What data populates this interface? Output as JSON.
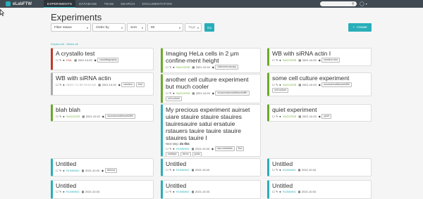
{
  "nav": {
    "brand": "eLabFTW",
    "items": [
      "EXPERIMENTS",
      "DATABASE",
      "TEAM",
      "SEARCH",
      "DOCUMENTATION"
    ],
    "active_index": 0
  },
  "page": {
    "title": "Experiments"
  },
  "filters": {
    "status": "Filter status",
    "order": "Order by",
    "sort": "Sort",
    "limit": "60",
    "tags": "Tags",
    "go_label": "Go",
    "create_label": "Create"
  },
  "expand": {
    "expand_all": "Expand all",
    "separator": " - ",
    "select_all": "Select all"
  },
  "colors": {
    "accent": "#29aeb9",
    "fail": "#c0392b",
    "success": "#6aaa2a",
    "need_redo": "#aaaaaa",
    "running": "#29aeb9"
  },
  "cards": [
    {
      "title": "A crystallo test",
      "status": "FAIL",
      "status_color": "#c0392b",
      "date": "2021.10.03",
      "tags": [
        "crystallography"
      ]
    },
    {
      "title": "Imaging HeLa cells in 2 μm confine-ment height",
      "status": "SUCCESS",
      "status_color": "#6aaa2a",
      "date": "2021.10.03",
      "tags": [
        "videomicroscopy"
      ]
    },
    {
      "title": "WB with siRNA actin I",
      "status": "SUCCESS",
      "status_color": "#6aaa2a",
      "date": "2021.10.03",
      "tags": [
        "western blot"
      ]
    },
    {
      "title": "WB with siRNA actin",
      "status": "NEED TO BE REDONE",
      "status_color": "#aaaaaa",
      "date": "2021.10.03",
      "tags": [
        "western",
        "blot"
      ]
    },
    {
      "title": "another cell culture experiment but much cooler",
      "status": "SUCCESS",
      "status_color": "#6aaa2a",
      "date": "2021.10.03",
      "tags": [
        "ecoaccessmodeltravelsfffn",
        "cell culture"
      ]
    },
    {
      "title": "some cell culture experiment",
      "status": "SUCCESS",
      "status_color": "#6aaa2a",
      "date": "2021.10.03",
      "tags": [
        "accessmodeltravelsfffn",
        "cell culture"
      ]
    },
    {
      "title": "blah blah",
      "status": "SUCCESS",
      "status_color": "#6aaa2a",
      "date": "2021.10.03",
      "tags": [
        "accessmodeltravelsfffn"
      ]
    },
    {
      "title": "My precious experiment auirset uiare stauire stauire stauires tauiresauire satui ersatuie rstauers tauire tauire stauire stauires tauire I",
      "status": "RUNNING",
      "status_color": "#29aeb9",
      "date": "2021.10.03",
      "tags": [
        "has-metadata",
        "fluo",
        "mathjax",
        "demo",
        "yoda"
      ],
      "next_step_label": "Next step:",
      "next_step": "do this"
    },
    {
      "title": "quiet experiment",
      "status": "SUCCESS",
      "status_color": "#6aaa2a",
      "date": "2021.10.03",
      "tags": [
        "quiet"
      ]
    },
    {
      "title": "Untitled",
      "status": "RUNNING",
      "status_color": "#29aeb9",
      "date": "2021.10.03",
      "tags": [
        "abecue"
      ]
    },
    {
      "title": "Untitled",
      "status": "RUNNING",
      "status_color": "#29aeb9",
      "date": "2021.10.03",
      "tags": []
    },
    {
      "title": "Untitled",
      "status": "RUNNING",
      "status_color": "#29aeb9",
      "date": "2021.10.03",
      "tags": []
    },
    {
      "title": "Untitled",
      "status": "RUNNING",
      "status_color": "#29aeb9",
      "date": "2021.10.03",
      "tags": []
    },
    {
      "title": "Untitled",
      "status": "RUNNING",
      "status_color": "#29aeb9",
      "date": "2021.10.03",
      "tags": []
    },
    {
      "title": "Untitled",
      "status": "RUNNING",
      "status_color": "#29aeb9",
      "date": "2021.10.03",
      "tags": []
    }
  ]
}
